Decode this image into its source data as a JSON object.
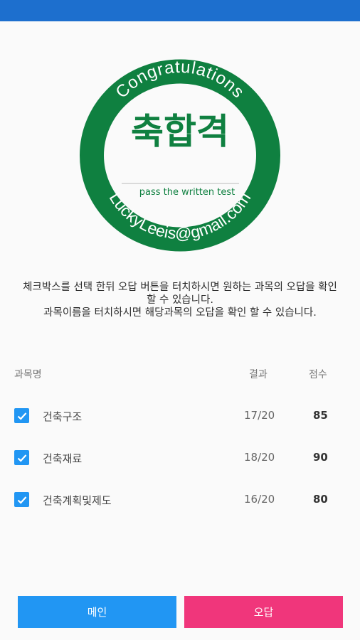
{
  "badge": {
    "top_text": "Congratulations",
    "main_text": "축합격",
    "sub_text": "pass the written test",
    "bottom_text": "LuckyLeeis@gmail.com",
    "color": "#0f8040"
  },
  "instructions": {
    "line1": "체크박스를 선택 한뒤 오답 버튼을 터치하시면 원하는 과목의 오답을 확인 할 수 있습니다.",
    "line2": "과목이름을 터치하시면 해당과목의 오답을 확인 할 수 있습니다."
  },
  "table": {
    "headers": {
      "subject": "과목명",
      "result": "결과",
      "score": "점수"
    },
    "rows": [
      {
        "subject": "건축구조",
        "result": "17/20",
        "score": "85",
        "checked": true
      },
      {
        "subject": "건축재료",
        "result": "18/20",
        "score": "90",
        "checked": true
      },
      {
        "subject": "건축계획및제도",
        "result": "16/20",
        "score": "80",
        "checked": true
      }
    ]
  },
  "buttons": {
    "main": "메인",
    "wrong": "오답"
  },
  "colors": {
    "status_bar": "#1d6fce",
    "primary": "#2196f3",
    "accent": "#f0367b"
  }
}
